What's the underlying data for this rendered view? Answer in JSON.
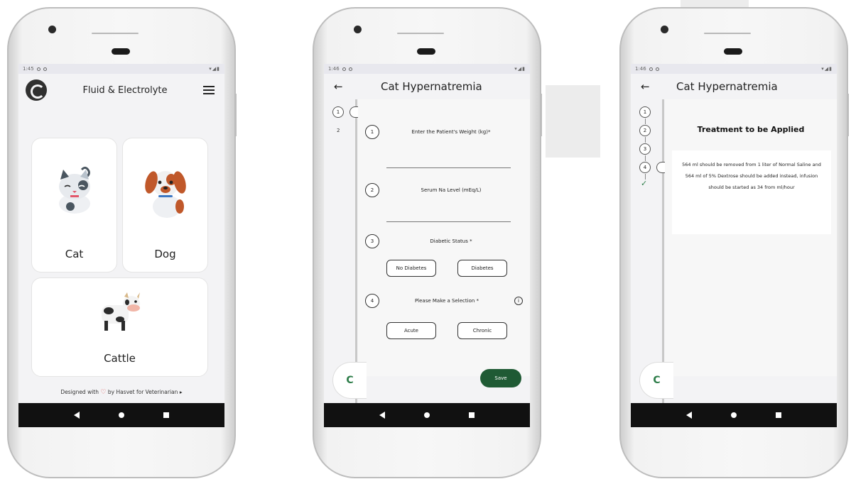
{
  "screen1": {
    "status_time": "1:45",
    "app_title": "Fluid & Electrolyte",
    "animals": [
      {
        "label": "Cat"
      },
      {
        "label": "Dog"
      },
      {
        "label": "Cattle"
      }
    ],
    "footer_prefix": "Designed with",
    "footer_suffix": "by Hasvet for Veterinarian"
  },
  "screen2": {
    "status_time": "1:46",
    "title": "Cat Hypernatremia",
    "steps": [
      "1",
      "2"
    ],
    "questions": [
      {
        "num": "1",
        "label": "Enter the Patient's Weight (kg)*"
      },
      {
        "num": "2",
        "label": "Serum Na Level (mEq/L)"
      },
      {
        "num": "3",
        "label": "Diabetic Status *"
      },
      {
        "num": "4",
        "label": "Please Make a Selection *"
      }
    ],
    "diabetic_options": [
      "No Diabetes",
      "Diabetes"
    ],
    "type_options": [
      "Acute",
      "Chronic"
    ],
    "save_label": "Save"
  },
  "screen3": {
    "status_time": "1:46",
    "title": "Cat Hypernatremia",
    "steps": [
      "1",
      "2",
      "3",
      "4"
    ],
    "treatment_title": "Treatment to be Applied",
    "treatment_text": "564 ml should be removed from 1 liter of Normal Saline and 564 ml of 5% Dextrose should be added instead, infusion should be started as 34 from ml/hour"
  },
  "colors": {
    "accent_green": "#1f5a34",
    "heart_red": "#e05757"
  }
}
